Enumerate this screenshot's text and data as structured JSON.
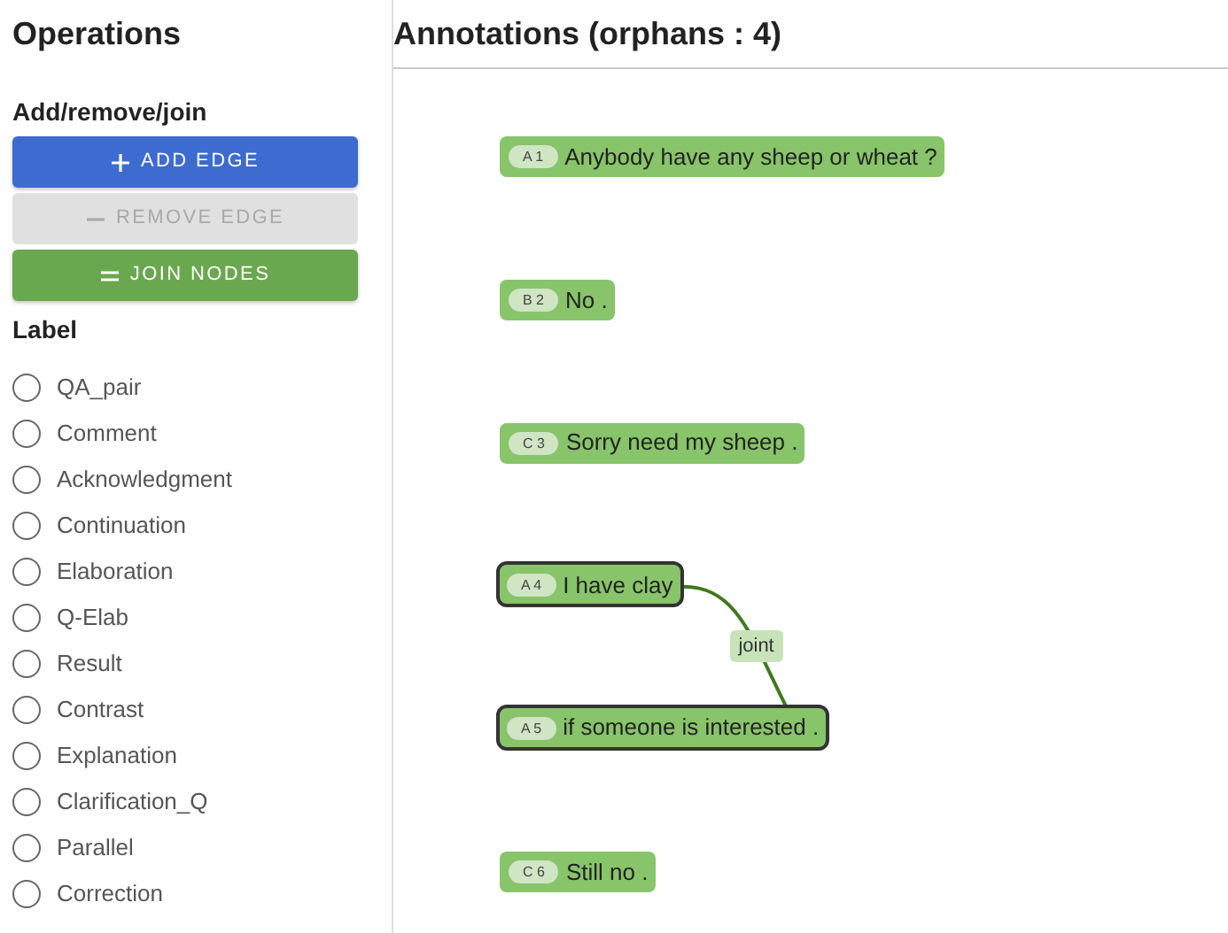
{
  "sidebar": {
    "title": "Operations",
    "section": "Add/remove/join",
    "buttons": [
      {
        "label": "ADD EDGE",
        "kind": "primary",
        "disabled": false
      },
      {
        "label": "REMOVE EDGE",
        "kind": "secondary",
        "disabled": true
      },
      {
        "label": "JOIN NODES",
        "kind": "success",
        "disabled": false
      }
    ],
    "label_heading": "Label",
    "labels": [
      {
        "text": "QA_pair",
        "selected": false
      },
      {
        "text": "Comment",
        "selected": false
      },
      {
        "text": "Acknowledgment",
        "selected": false
      },
      {
        "text": "Continuation",
        "selected": false
      },
      {
        "text": "Elaboration",
        "selected": false
      },
      {
        "text": "Q-Elab",
        "selected": false
      },
      {
        "text": "Result",
        "selected": false
      },
      {
        "text": "Contrast",
        "selected": false
      },
      {
        "text": "Explanation",
        "selected": false
      },
      {
        "text": "Clarification_Q",
        "selected": false
      },
      {
        "text": "Parallel",
        "selected": false
      },
      {
        "text": "Correction",
        "selected": false
      }
    ]
  },
  "annotations": {
    "title": "Annotations (orphans : 4)",
    "nodes": [
      {
        "tag": "A 1",
        "text": "Anybody have any sheep or wheat ?",
        "selected": false
      },
      {
        "tag": "B 2",
        "text": "No .",
        "selected": false
      },
      {
        "tag": "C 3",
        "text": "Sorry need my sheep .",
        "selected": false
      },
      {
        "tag": "A 4",
        "text": "I have clay",
        "selected": true,
        "edge_to_next": "joint"
      },
      {
        "tag": "A 5",
        "text": "if someone is interested .",
        "selected": true
      },
      {
        "tag": "C 6",
        "text": "Still no .",
        "selected": false
      }
    ]
  }
}
